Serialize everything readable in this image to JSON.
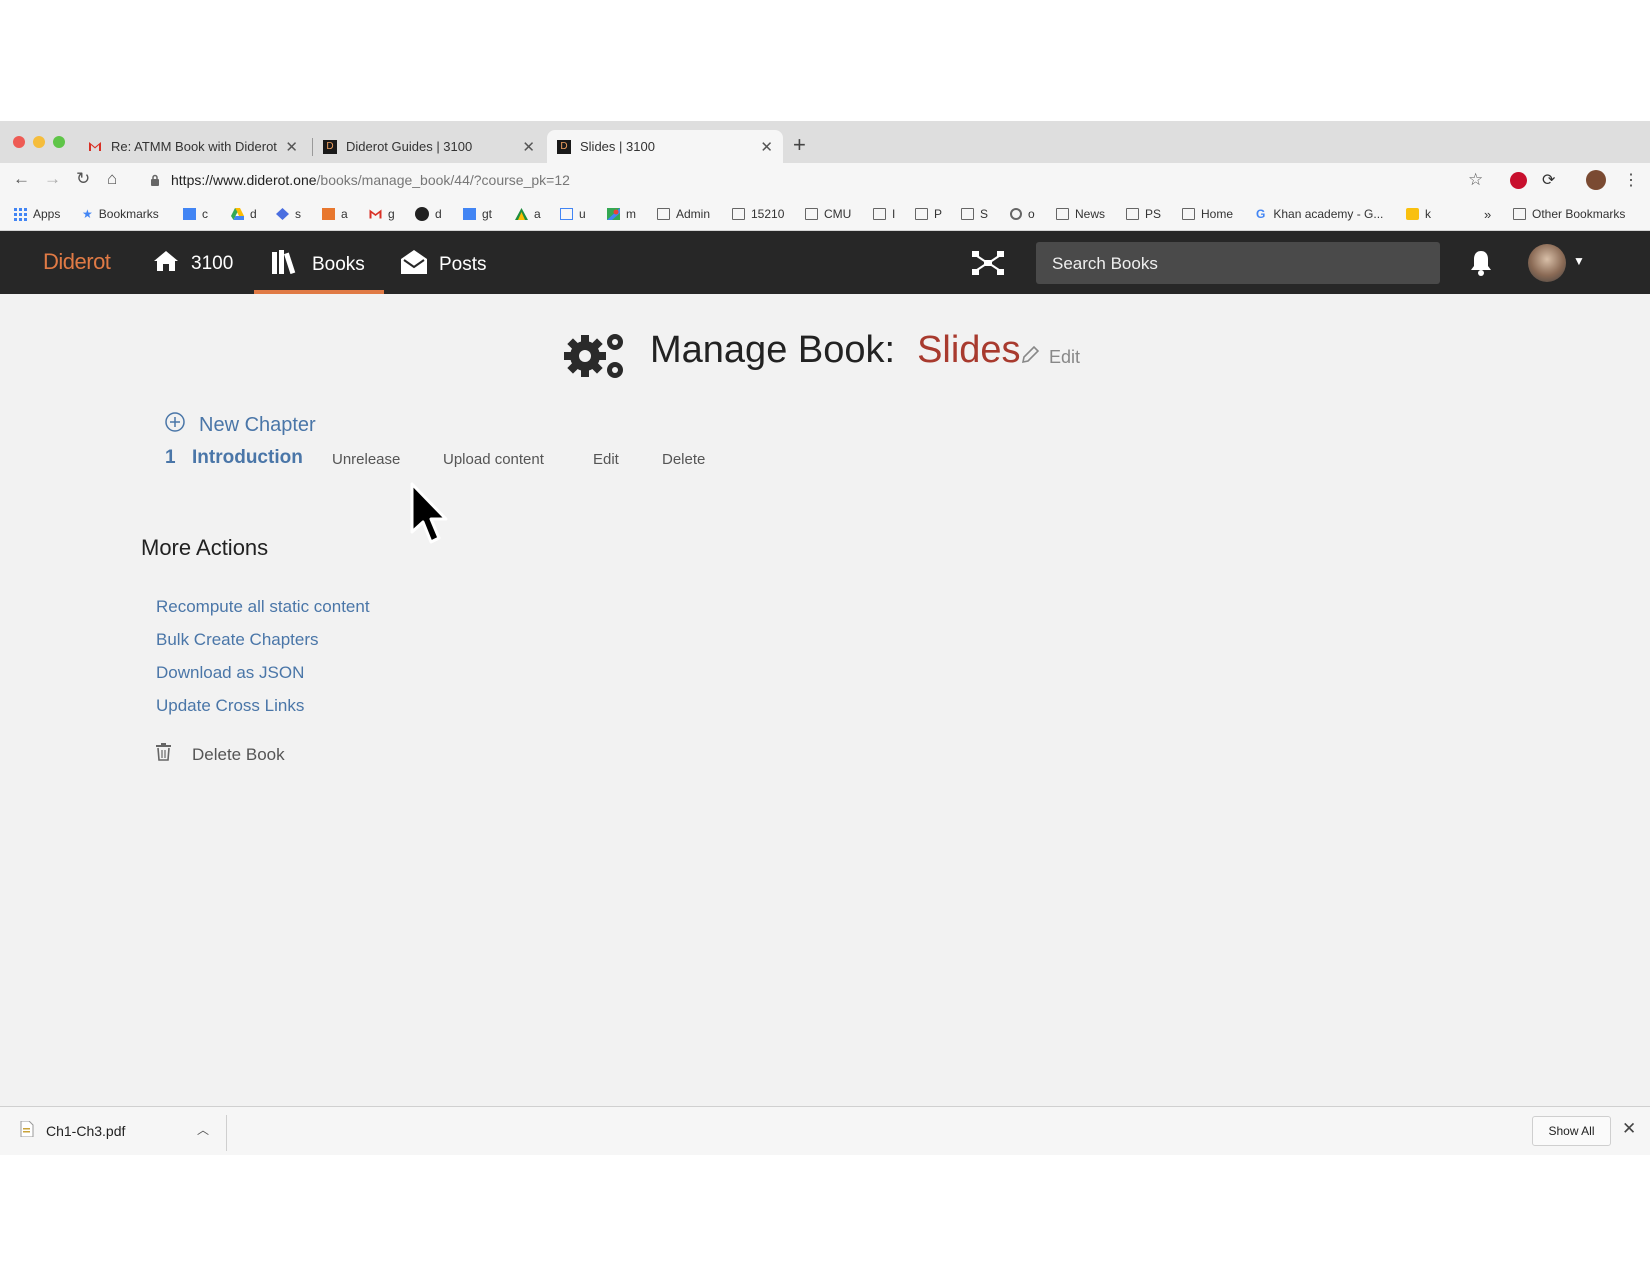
{
  "browser": {
    "tabs": [
      {
        "title": "Re: ATMM Book with Diderot -",
        "icon": "gmail-icon"
      },
      {
        "title": "Diderot Guides | 3100",
        "icon": "diderot-favicon"
      },
      {
        "title": "Slides | 3100",
        "icon": "diderot-favicon",
        "active": true
      }
    ],
    "url_host": "https://www.diderot.one",
    "url_path": "/books/manage_book/44/?course_pk=12",
    "favicon_letter": "D",
    "bookmarks": [
      {
        "label": "Apps",
        "icon": "apps-grid-icon"
      },
      {
        "label": "Bookmarks",
        "icon": "star-icon"
      },
      {
        "label": "c",
        "icon": "calendar-icon"
      },
      {
        "label": "d",
        "icon": "drive-icon"
      },
      {
        "label": "s",
        "icon": "diamond-icon"
      },
      {
        "label": "a",
        "icon": "box-icon"
      },
      {
        "label": "g",
        "icon": "gmail-icon"
      },
      {
        "label": "d",
        "icon": "github-icon"
      },
      {
        "label": "gt",
        "icon": "translate-icon"
      },
      {
        "label": "a",
        "icon": "triangle-icon"
      },
      {
        "label": "u",
        "icon": "table-icon"
      },
      {
        "label": "m",
        "icon": "maps-icon"
      },
      {
        "label": "Admin",
        "icon": "folder-icon"
      },
      {
        "label": "15210",
        "icon": "folder-icon"
      },
      {
        "label": "CMU",
        "icon": "folder-icon"
      },
      {
        "label": "I",
        "icon": "folder-icon"
      },
      {
        "label": "P",
        "icon": "folder-icon"
      },
      {
        "label": "S",
        "icon": "folder-icon"
      },
      {
        "label": "o",
        "icon": "chrome-icon"
      },
      {
        "label": "News",
        "icon": "folder-icon"
      },
      {
        "label": "PS",
        "icon": "folder-icon"
      },
      {
        "label": "Home",
        "icon": "folder-icon"
      },
      {
        "label": "Khan academy - G...",
        "icon": "google-icon"
      },
      {
        "label": "k",
        "icon": "keep-icon"
      }
    ],
    "overflow_label": "»",
    "other_bookmarks": "Other Bookmarks"
  },
  "site": {
    "logo": "Diderot",
    "nav": [
      {
        "label": "3100",
        "icon": "home-icon"
      },
      {
        "label": "Books",
        "icon": "books-icon",
        "active": true
      },
      {
        "label": "Posts",
        "icon": "envelope-icon"
      }
    ],
    "search_placeholder": "Search Books"
  },
  "page": {
    "title_prefix": "Manage Book:",
    "book_name": "Slides",
    "edit_label": "Edit",
    "new_chapter_label": "New Chapter",
    "chapters": [
      {
        "number": "1",
        "title": "Introduction",
        "actions": [
          "Unrelease",
          "Upload content",
          "Edit",
          "Delete"
        ]
      }
    ],
    "more_actions_heading": "More Actions",
    "more_actions": [
      "Recompute all static content",
      "Bulk Create Chapters",
      "Download as JSON",
      "Update Cross Links"
    ],
    "delete_book_label": "Delete Book"
  },
  "downloads": {
    "file_name": "Ch1-Ch3.pdf",
    "show_all_label": "Show All"
  },
  "colors": {
    "accent": "#e07a45",
    "book_name": "#a83a2e",
    "link": "#4a76a8",
    "nav_bg": "#272727"
  }
}
